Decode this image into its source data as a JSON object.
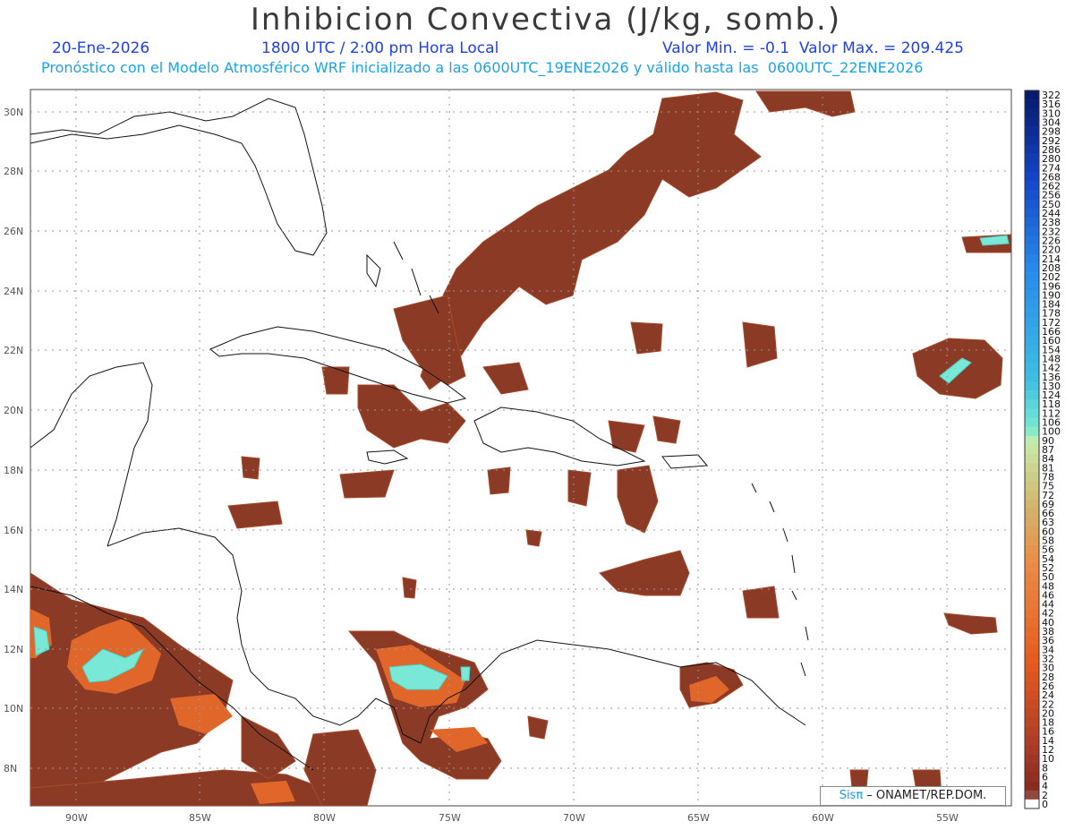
{
  "header": {
    "title": "Inhibicion Convectiva (J/kg, somb.)",
    "date": "20-Ene-2026",
    "time": "1800 UTC / 2:00 pm Hora Local",
    "range": "Valor Min. = -0.1  Valor Max. = 209.425",
    "description": "Pronóstico con el Modelo Atmosférico WRF inicializado a las 0600UTC_19ENE2026 y válido hasta las  0600UTC_22ENE2026"
  },
  "map": {
    "lat_labels": [
      "30N",
      "28N",
      "26N",
      "24N",
      "22N",
      "20N",
      "18N",
      "16N",
      "14N",
      "12N",
      "10N",
      "8N"
    ],
    "lon_labels": [
      "90W",
      "85W",
      "80W",
      "75W",
      "70W",
      "65W",
      "60W",
      "55W"
    ],
    "colors": {
      "cin_fill": "#8b3a26",
      "cin_edge": "#a84a2a",
      "high_orange": "#e0662a",
      "max_cyan": "#79e8d6",
      "coast": "#111111",
      "grid": "#9a9a9a"
    }
  },
  "colorbar": {
    "labels": [
      "322",
      "316",
      "310",
      "304",
      "298",
      "292",
      "286",
      "280",
      "274",
      "268",
      "262",
      "256",
      "250",
      "244",
      "238",
      "232",
      "226",
      "220",
      "214",
      "208",
      "202",
      "196",
      "190",
      "184",
      "178",
      "172",
      "166",
      "160",
      "154",
      "148",
      "142",
      "136",
      "130",
      "124",
      "118",
      "112",
      "106",
      "100",
      "90",
      "87",
      "84",
      "81",
      "78",
      "75",
      "72",
      "69",
      "66",
      "63",
      "60",
      "58",
      "56",
      "54",
      "52",
      "50",
      "48",
      "46",
      "44",
      "42",
      "40",
      "38",
      "36",
      "34",
      "32",
      "30",
      "28",
      "26",
      "24",
      "22",
      "20",
      "18",
      "16",
      "14",
      "12",
      "10",
      "8",
      "6",
      "4",
      "2",
      "0"
    ]
  },
  "credit": {
    "brand": "Sisπ",
    "text": " – ONAMET/REP.DOM."
  }
}
